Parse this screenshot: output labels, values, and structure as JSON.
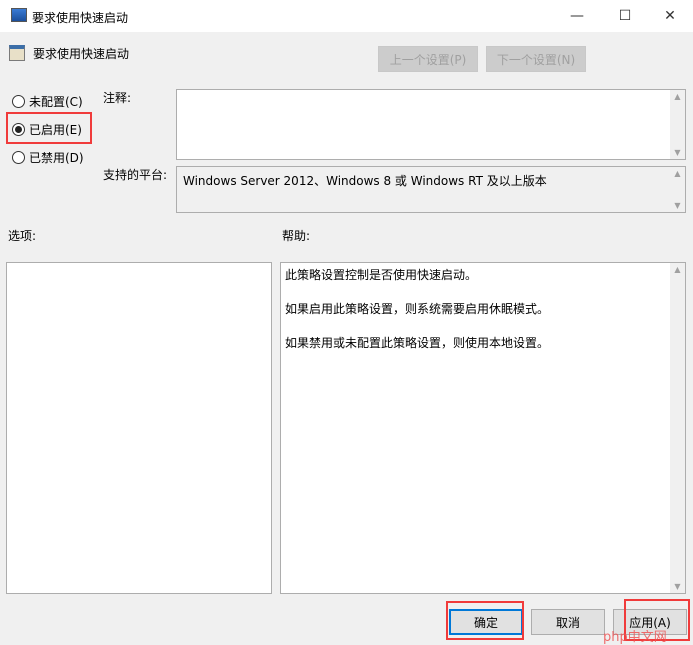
{
  "window": {
    "title": "要求使用快速启动",
    "minimize": "—",
    "maximize": "☐",
    "close": "✕"
  },
  "header": {
    "title": "要求使用快速启动",
    "prev_label": "上一个设置(P)",
    "next_label": "下一个设置(N)"
  },
  "radios": [
    {
      "label": "未配置(C)",
      "checked": false
    },
    {
      "label": "已启用(E)",
      "checked": true
    },
    {
      "label": "已禁用(D)",
      "checked": false
    }
  ],
  "comment": {
    "label": "注释:",
    "value": ""
  },
  "platform": {
    "label": "支持的平台:",
    "value": "Windows Server 2012、Windows 8 或 Windows RT 及以上版本"
  },
  "options": {
    "label": "选项:"
  },
  "help": {
    "label": "帮助:",
    "paragraphs": [
      "此策略设置控制是否使用快速启动。",
      "如果启用此策略设置，则系统需要启用休眠模式。",
      "如果禁用或未配置此策略设置，则使用本地设置。"
    ]
  },
  "footer": {
    "ok": "确定",
    "cancel": "取消",
    "apply": "应用(A)"
  },
  "watermark": "php中文网",
  "colors": {
    "highlight": "#f03b3b",
    "focus": "#0078d7"
  }
}
